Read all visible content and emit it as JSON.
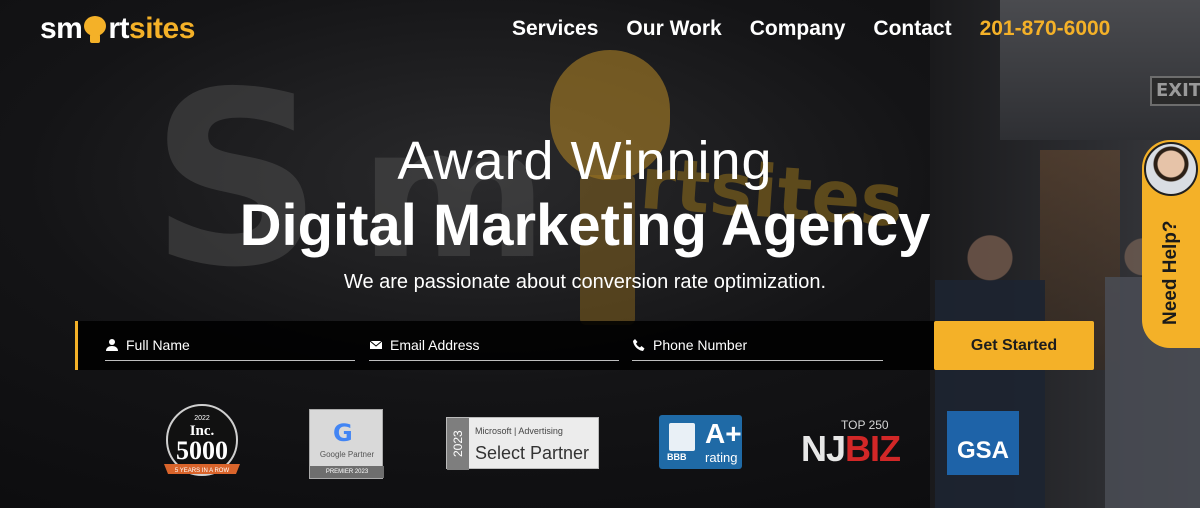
{
  "header": {
    "logo_part1": "sm",
    "logo_part2": "rt",
    "logo_part3": "sites",
    "nav": [
      {
        "label": "Services"
      },
      {
        "label": "Our Work"
      },
      {
        "label": "Company"
      },
      {
        "label": "Contact"
      }
    ],
    "phone": "201-870-6000",
    "accent_color": "#f4b128"
  },
  "hero": {
    "headline_line1": "Award Winning",
    "headline_line2": "Digital Marketing Agency",
    "subheadline": "We are passionate about conversion rate optimization."
  },
  "form": {
    "name_placeholder": "Full Name",
    "email_placeholder": "Email Address",
    "phone_placeholder": "Phone Number",
    "name_value": "",
    "email_value": "",
    "phone_value": "",
    "submit_label": "Get Started"
  },
  "badges": {
    "inc_year": "2022",
    "inc_title": "Inc.",
    "inc_number": "5000",
    "inc_ribbon": "5 YEARS IN A ROW",
    "google_logo": "G",
    "google_label": "Google Partner",
    "google_premier": "PREMIER 2023",
    "ms_year": "2023",
    "ms_brand": "Microsoft | Advertising",
    "ms_label": "Select Partner",
    "bbb_short": "BBB",
    "bbb_grade": "A+",
    "bbb_rating": "rating",
    "njbiz_top": "TOP 250",
    "njbiz_nj": "NJ",
    "njbiz_biz": "BIZ",
    "gsa": "GSA"
  },
  "help": {
    "label": "Need Help?"
  },
  "background": {
    "exit_sign": "EXIT"
  }
}
